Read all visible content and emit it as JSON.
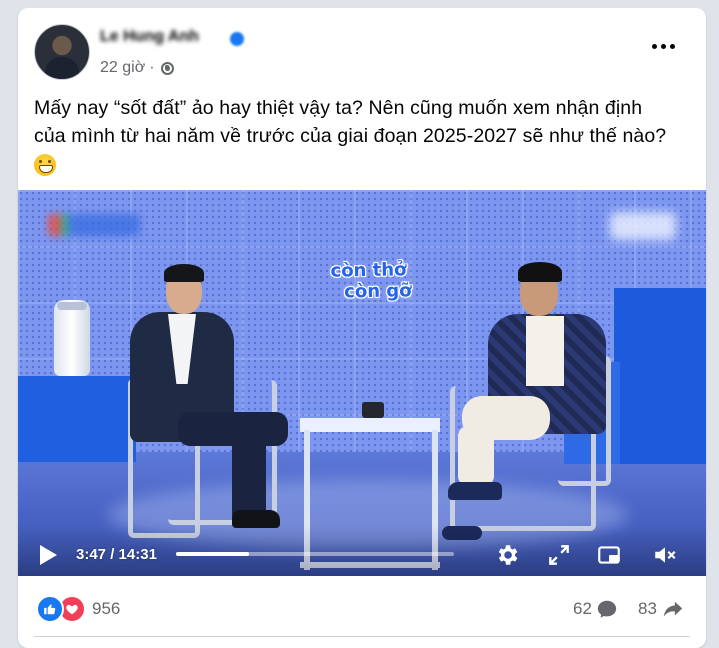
{
  "post": {
    "author_name": "Le Hung Anh",
    "timestamp": "22 giờ",
    "separator": "·",
    "privacy_icon": "globe-icon",
    "more_icon": "more-options-icon",
    "text_line1": "Mấy nay “sốt đất” ảo hay thiệt vậy ta? Nên cũng muốn xem nhận định",
    "text_line2": "của mình từ  hai năm về trước của giai đoạn 2025-2027 sẽ như thế nào?",
    "emoji_icon": "grinning-face-icon"
  },
  "video": {
    "watermark_line1": "còn thở",
    "watermark_line2": "còn gỡ",
    "current_time": "3:47",
    "time_separator": " / ",
    "duration": "14:31",
    "progress_fraction": 0.261,
    "icons": [
      "play-icon",
      "settings-icon",
      "fullscreen-icon",
      "picture-in-picture-icon",
      "mute-icon"
    ]
  },
  "footer": {
    "reaction_icons": [
      "like-icon",
      "love-icon"
    ],
    "reaction_count": "956",
    "comment_count": "62",
    "comment_icon": "comment-icon",
    "share_count": "83",
    "share_icon": "share-icon"
  },
  "colors": {
    "like": "#1877f2",
    "love": "#f33e58",
    "text": "#050505",
    "secondary_text": "#65676b",
    "video_watermark": "#2563eb"
  }
}
